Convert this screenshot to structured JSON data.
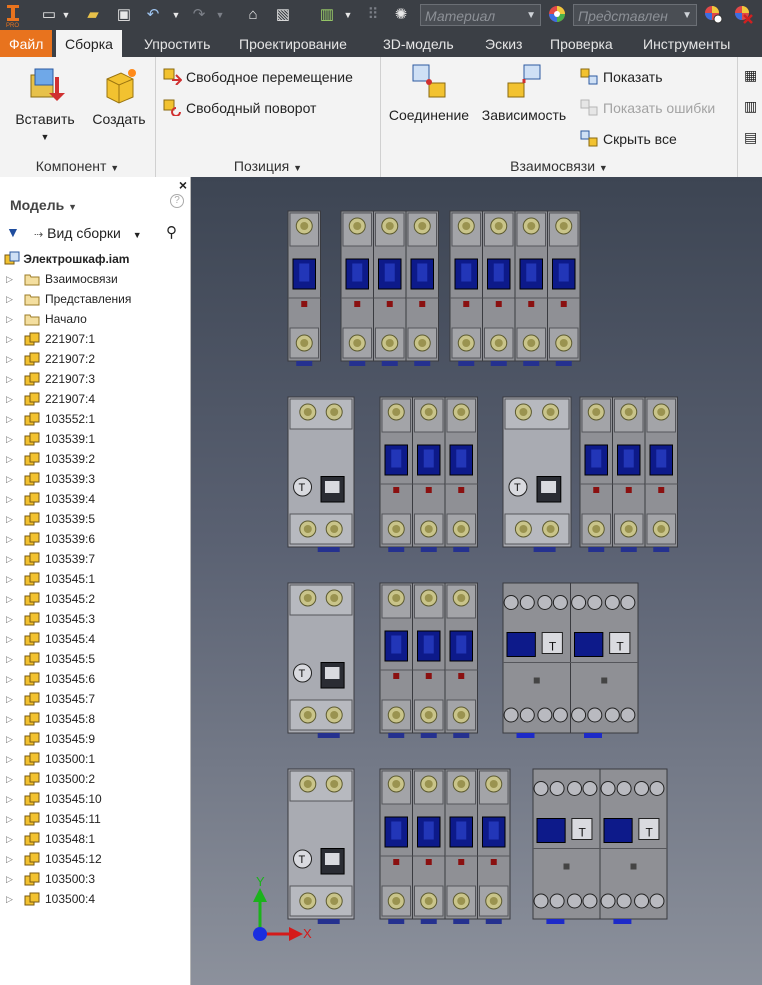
{
  "qat": {
    "material_placeholder": "Материал",
    "appearance_placeholder": "Представлен"
  },
  "tabs": [
    "Файл",
    "Сборка",
    "Упростить",
    "Проектирование",
    "3D-модель",
    "Эскиз",
    "Проверка",
    "Инструменты"
  ],
  "active_tab": "Сборка",
  "ribbon": {
    "component": {
      "title": "Компонент",
      "insert": "Вставить",
      "create": "Создать"
    },
    "position": {
      "title": "Позиция",
      "free_move": "Свободное перемещение",
      "free_rotate": "Свободный поворот"
    },
    "relationships": {
      "title": "Взаимосвязи",
      "joint": "Соединение",
      "constrain": "Зависимость",
      "show": "Показать",
      "show_errors": "Показать ошибки",
      "hide_all": "Скрыть все"
    }
  },
  "browser": {
    "title": "Модель",
    "view": "Вид сборки",
    "root": "Электрошкаф.iam",
    "items": [
      "Взаимосвязи",
      "Представления",
      "Начало",
      "221907:1",
      "221907:2",
      "221907:3",
      "221907:4",
      "103552:1",
      "103539:1",
      "103539:2",
      "103539:3",
      "103539:4",
      "103539:5",
      "103539:6",
      "103539:7",
      "103545:1",
      "103545:2",
      "103545:3",
      "103545:4",
      "103545:5",
      "103545:6",
      "103545:7",
      "103545:8",
      "103545:9",
      "103500:1",
      "103500:2",
      "103545:10",
      "103545:11",
      "103548:1",
      "103545:12",
      "103500:3",
      "103500:4"
    ]
  },
  "viewcube": {
    "x_label": "X",
    "y_label": "Y"
  },
  "colors": {
    "file_tab": "#e8731e",
    "toolbar_bg": "#3b3f45",
    "breaker_body": "#8f9095",
    "toggle": "#0d1a8a"
  }
}
